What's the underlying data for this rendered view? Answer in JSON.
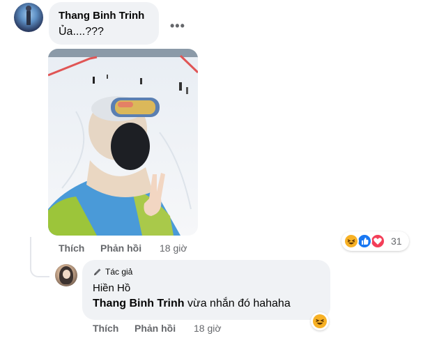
{
  "comment": {
    "author": "Thang Binh Trinh",
    "text": "Ủa....???",
    "more_icon": "•••",
    "actions": {
      "like": "Thích",
      "reply": "Phản hồi",
      "time": "18 giờ"
    },
    "reactions": {
      "icons": [
        "haha-icon",
        "like-icon",
        "love-icon"
      ],
      "count": "31",
      "colors": {
        "haha": "#f7b125",
        "like": "#1877f2",
        "love": "#f33e58"
      }
    }
  },
  "reply": {
    "badge": "Tác giả",
    "author": "Hiền Hồ",
    "mention": "Thang Binh Trinh",
    "text": " vừa nhắn đó hahaha",
    "actions": {
      "like": "Thích",
      "reply": "Phản hồi",
      "time": "18 giờ"
    }
  },
  "colors": {
    "bubble": "#f0f2f5",
    "secondary_text": "#65676b",
    "primary_text": "#050505"
  }
}
